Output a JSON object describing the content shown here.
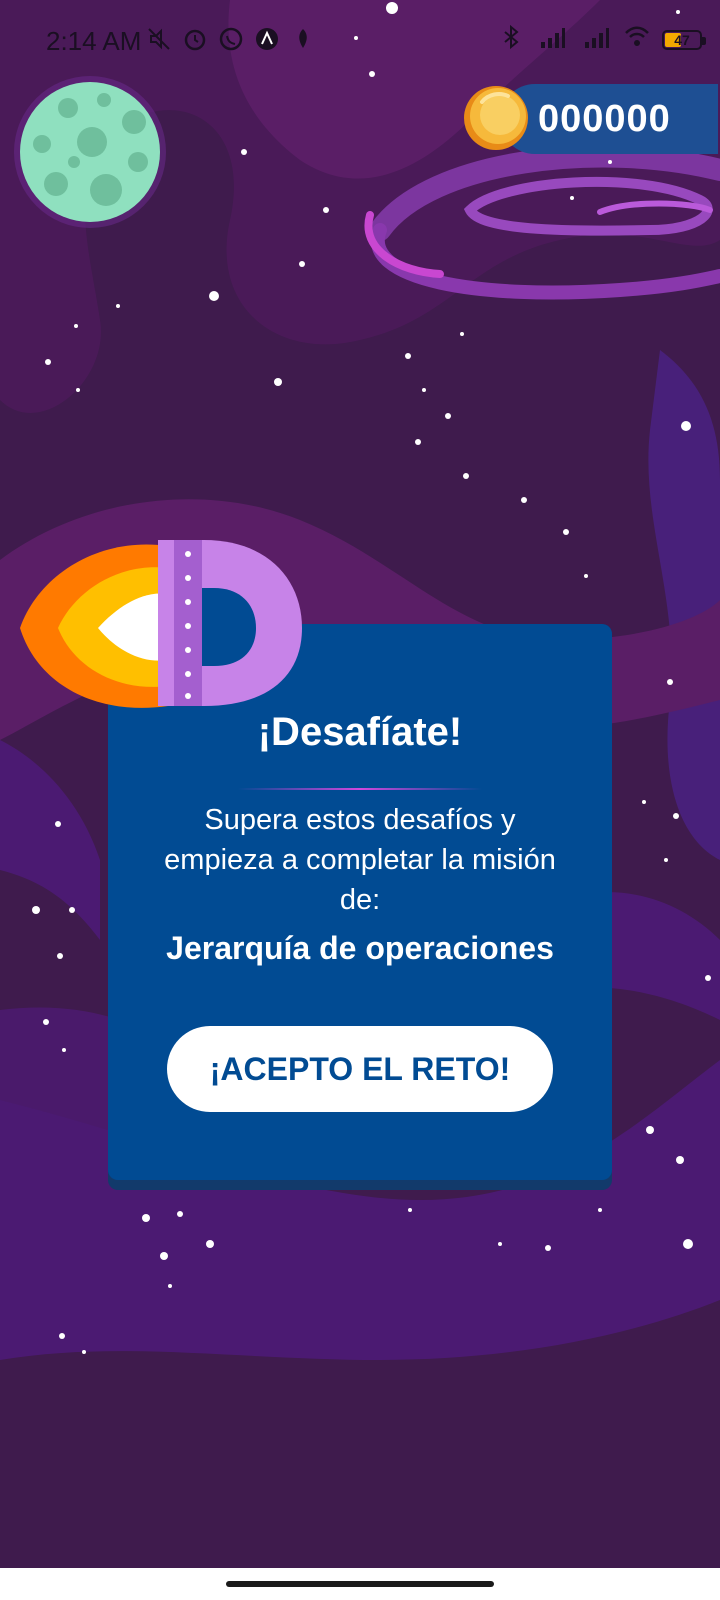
{
  "status_bar": {
    "time": "2:14 AM",
    "battery_level": "47",
    "icons_left": [
      "mute-icon",
      "alarm-icon",
      "whatsapp-icon",
      "app-icon",
      "notification-icon"
    ],
    "icons_right": [
      "bluetooth-icon",
      "signal-icon",
      "signal-icon",
      "wifi-icon",
      "battery-icon"
    ]
  },
  "coins": {
    "value": "000000"
  },
  "challenge_card": {
    "title": "¡Desafíate!",
    "description": "Supera estos desafíos y empieza a completar la misión de:",
    "mission_name": "Jerarquía de operaciones",
    "accept_button_label": "¡ACEPTO EL RETO!"
  },
  "colors": {
    "background": "#3f1b4d",
    "card": "#014b93",
    "coin_pill": "#1e4f93",
    "accent_purple": "#c98be8",
    "flame_orange": "#ff7a00"
  }
}
